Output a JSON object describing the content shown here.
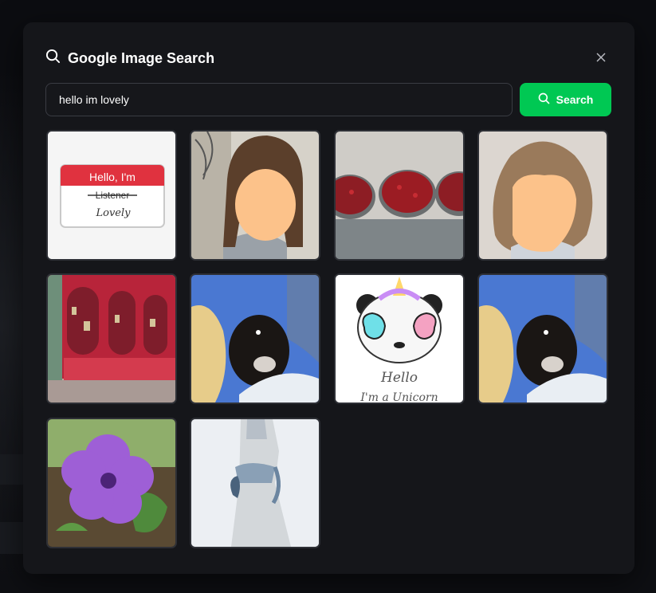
{
  "dialog": {
    "title": "Google Image Search",
    "close_icon": "close-icon",
    "search_icon": "search-icon"
  },
  "search": {
    "value": "hello im lovely",
    "button_label": "Search",
    "button_color": "#00c853"
  },
  "results": [
    {
      "name": "result-hello-im-sticker",
      "text_1": "Hello, I'm",
      "text_2": "Listener",
      "text_3": "Lovely"
    },
    {
      "name": "result-person-portrait-1"
    },
    {
      "name": "result-cranberry-bowls"
    },
    {
      "name": "result-person-portrait-2"
    },
    {
      "name": "result-red-bookshelf-room"
    },
    {
      "name": "result-selfie-with-dog-1"
    },
    {
      "name": "result-hello-unicorn-panda",
      "text_1": "Hello",
      "text_2": "I'm a Unicorn"
    },
    {
      "name": "result-selfie-with-dog-2"
    },
    {
      "name": "result-purple-flower"
    },
    {
      "name": "result-person-in-white-dress"
    }
  ]
}
